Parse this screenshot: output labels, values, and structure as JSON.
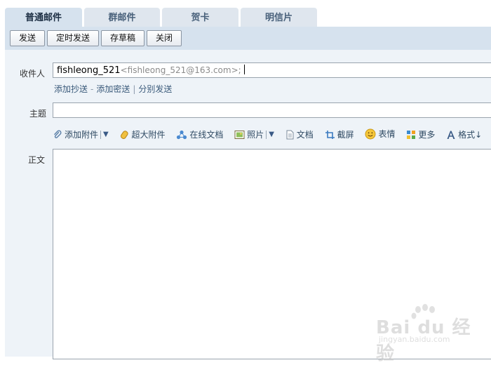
{
  "tabs": [
    {
      "label": "普通邮件",
      "active": true
    },
    {
      "label": "群邮件",
      "active": false
    },
    {
      "label": "贺卡",
      "active": false
    },
    {
      "label": "明信片",
      "active": false
    }
  ],
  "toolbar": {
    "send": "发送",
    "scheduled_send": "定时发送",
    "save_draft": "存草稿",
    "close": "关闭"
  },
  "form": {
    "recipient_label": "收件人",
    "recipient_name": "fishleong_521",
    "recipient_address": "<fishleong_521@163.com>;",
    "add_cc": "添加抄送",
    "dash": "-",
    "add_bcc": "添加密送",
    "pipe": "|",
    "separate_send": "分别发送",
    "subject_label": "主题",
    "subject_value": "",
    "body_label": "正文",
    "body_value": ""
  },
  "attach_tools": [
    {
      "label": "添加附件",
      "icon": "paperclip-icon",
      "dropdown": true
    },
    {
      "label": "超大附件",
      "icon": "large-attachment-icon",
      "dropdown": false
    },
    {
      "label": "在线文档",
      "icon": "online-doc-icon",
      "dropdown": false
    },
    {
      "label": "照片",
      "icon": "photo-icon",
      "dropdown": true
    },
    {
      "label": "文档",
      "icon": "document-icon",
      "dropdown": false
    },
    {
      "label": "截屏",
      "icon": "screenshot-icon",
      "dropdown": false
    },
    {
      "label": "表情",
      "icon": "smiley-icon",
      "dropdown": false
    },
    {
      "label": "更多",
      "icon": "more-icon",
      "dropdown": false
    },
    {
      "label": "格式↓",
      "icon": "format-icon",
      "dropdown": false
    }
  ],
  "watermark": {
    "brand": "Bai du 经验",
    "url": "jingyan.baidu.com"
  },
  "colors": {
    "tab_active": "#d6e2ee",
    "toolbar": "#d6e2ee",
    "form_bg": "#eef3f8",
    "link": "#3a5a7a"
  }
}
